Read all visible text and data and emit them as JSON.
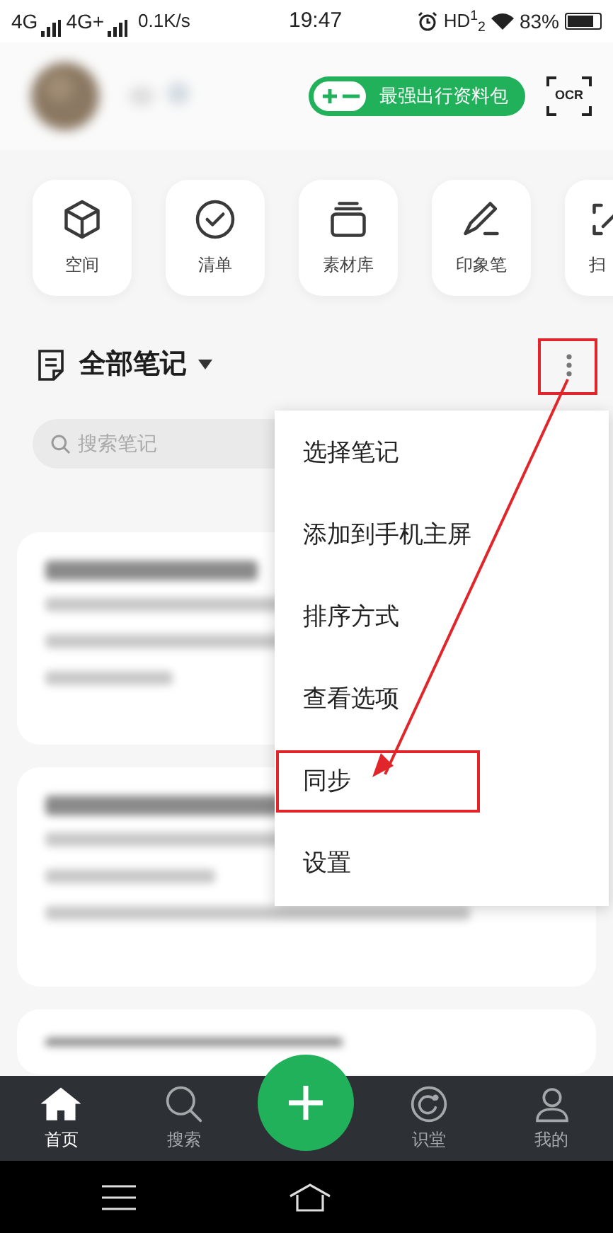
{
  "status_bar": {
    "networks": [
      "4G",
      "4G+"
    ],
    "speed": "0.1K/s",
    "time": "19:47",
    "hd": "HD$^{1}$$_{2}$",
    "battery": "83%"
  },
  "header": {
    "promo": "最强出行资料包",
    "ocr": "OCR"
  },
  "shortcuts": [
    {
      "label": "空间"
    },
    {
      "label": "清单"
    },
    {
      "label": "素材库"
    },
    {
      "label": "印象笔"
    },
    {
      "label": "扫"
    }
  ],
  "notes_header": {
    "title": "全部笔记",
    "more_annotated": true
  },
  "search": {
    "placeholder": "搜索笔记"
  },
  "menu": [
    {
      "label": "选择笔记",
      "annotated": false
    },
    {
      "label": "添加到手机主屏",
      "annotated": false
    },
    {
      "label": "排序方式",
      "annotated": false
    },
    {
      "label": "查看选项",
      "annotated": false
    },
    {
      "label": "同步",
      "annotated": true
    },
    {
      "label": "设置",
      "annotated": false
    }
  ],
  "bottom_nav": [
    {
      "label": "首页",
      "kind": "tab",
      "selected": true
    },
    {
      "label": "搜索",
      "kind": "tab",
      "selected": false
    },
    {
      "kind": "add"
    },
    {
      "label": "识堂",
      "kind": "tab",
      "selected": false
    },
    {
      "label": "我的",
      "kind": "tab",
      "selected": false
    }
  ]
}
